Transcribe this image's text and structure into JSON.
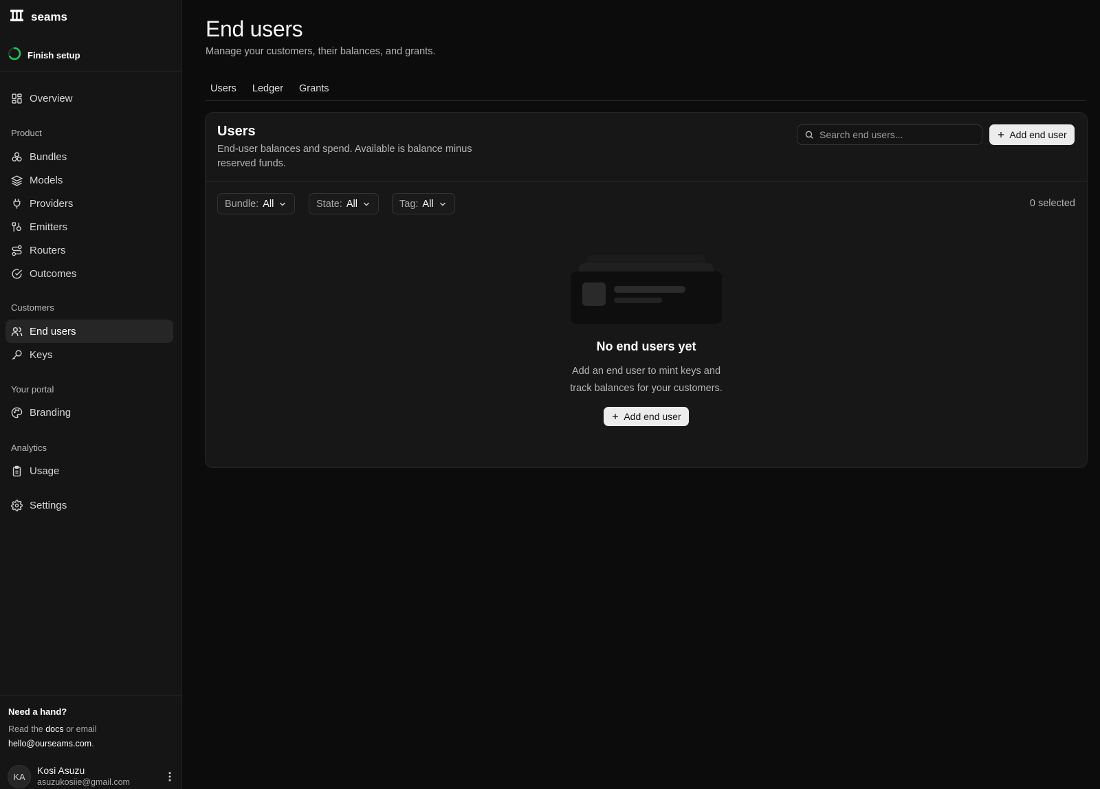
{
  "app": {
    "brand_name": "seams",
    "setup_label": "Finish setup",
    "setup_accent": "#22c55e"
  },
  "sidebar": {
    "overview": "Overview",
    "sections": {
      "product": "Product",
      "customers": "Customers",
      "portal": "Your portal",
      "analytics": "Analytics"
    },
    "items": {
      "bundles": "Bundles",
      "models": "Models",
      "providers": "Providers",
      "emitters": "Emitters",
      "routers": "Routers",
      "outcomes": "Outcomes",
      "end_users": "End users",
      "keys": "Keys",
      "branding": "Branding",
      "usage": "Usage",
      "settings": "Settings"
    },
    "help": {
      "title": "Need a hand?",
      "read_the": "Read the ",
      "docs": "docs",
      "or_email": " or email",
      "email": "hello@ourseams.com",
      "period": "."
    },
    "user": {
      "initials": "KA",
      "name": "Kosi Asuzu",
      "email": "asuzukosiie@gmail.com"
    }
  },
  "header": {
    "title": "End users",
    "subtitle": "Manage your customers, their balances, and grants."
  },
  "tabs": [
    "Users",
    "Ledger",
    "Grants"
  ],
  "card": {
    "title": "Users",
    "description": "End-user balances and spend. Available is balance minus reserved funds.",
    "search_placeholder": "Search end users...",
    "add_button": "Add end user",
    "filters": [
      {
        "label": "Bundle:",
        "value": "All"
      },
      {
        "label": "State:",
        "value": "All"
      },
      {
        "label": "Tag:",
        "value": "All"
      }
    ],
    "selected_count": "0 selected",
    "empty": {
      "title": "No end users yet",
      "line1": "Add an end user to mint keys and",
      "line2": "track balances for your customers.",
      "button": "Add end user"
    }
  }
}
